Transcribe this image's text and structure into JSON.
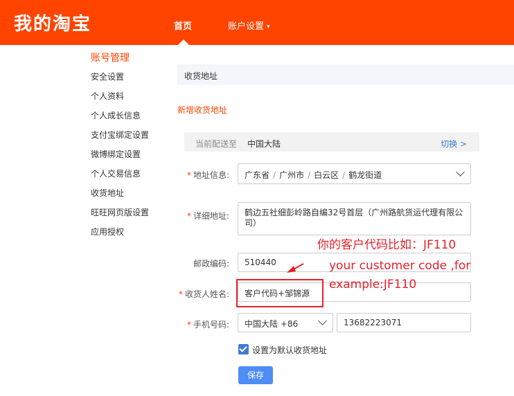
{
  "header": {
    "logo": "我的淘宝",
    "nav": {
      "home": "首页",
      "account_settings": "账户设置",
      "caret": "▾"
    }
  },
  "sidebar": {
    "heading": "账号管理",
    "items": [
      {
        "label": "安全设置"
      },
      {
        "label": "个人资料"
      },
      {
        "label": "个人成长信息"
      },
      {
        "label": "支付宝绑定设置"
      },
      {
        "label": "微博绑定设置"
      },
      {
        "label": "个人交易信息"
      },
      {
        "label": "收货地址"
      },
      {
        "label": "旺旺网页版设置"
      },
      {
        "label": "应用授权"
      }
    ]
  },
  "main": {
    "title": "收货地址",
    "add_link": "新增收货地址",
    "ship_to": {
      "label": "当前配送至",
      "value": "中国大陆",
      "switch": "切换 >"
    }
  },
  "form": {
    "required_mark": "*",
    "region": {
      "label": "地址信息:",
      "parts": [
        "广东省",
        "广州市",
        "白云区",
        "鹤龙街道"
      ],
      "separator": "/"
    },
    "detail": {
      "label": "详细地址:",
      "value": "鹤边五社细彭岭路自编32号首层（广州路航货运代理有限公司）"
    },
    "postal": {
      "label": "邮政编码:",
      "value": "510440"
    },
    "name": {
      "label": "收货人姓名:",
      "value": "客户代码+邹锦源"
    },
    "phone": {
      "label": "手机号码:",
      "country": "中国大陆 +86",
      "value": "13682223071"
    },
    "default_checkbox": {
      "label": "设置为默认收货地址",
      "checked": true
    },
    "save_button": "保存"
  },
  "annotation": {
    "line1": "你的客户代码比如：JF110",
    "line2": "your customer code ,for",
    "line3": "example:JF110",
    "color": "#e8202a"
  }
}
